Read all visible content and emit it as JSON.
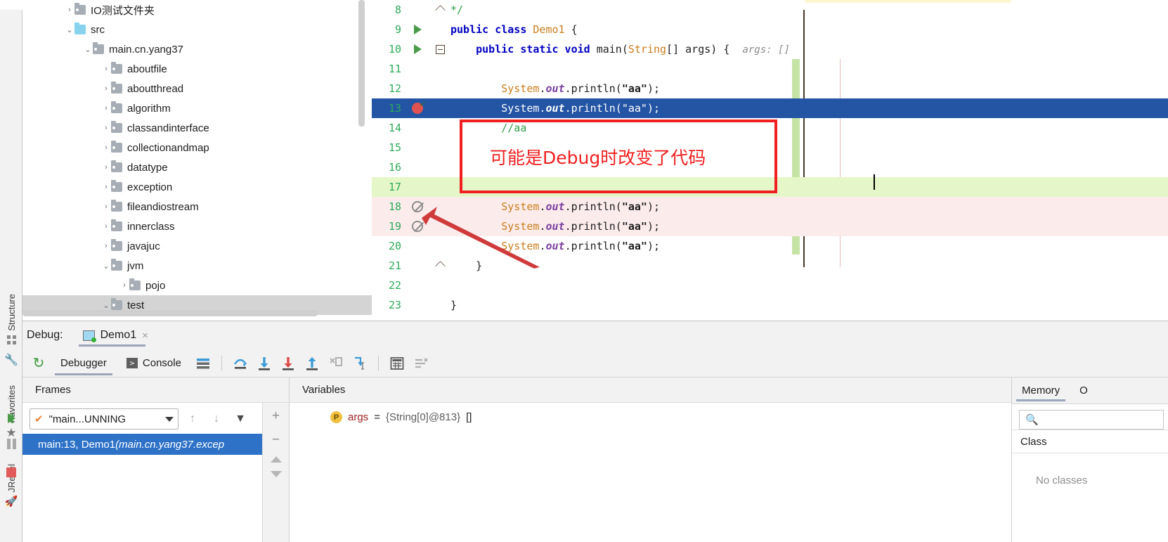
{
  "left_strip": {
    "tabs": [
      {
        "label": "Structure",
        "icon": "grid-icon"
      },
      {
        "label": "Favorites",
        "icon": "star-icon"
      },
      {
        "label": "JRebel",
        "icon": "rocket-icon"
      }
    ],
    "debug_controls": [
      {
        "name": "settings",
        "icon": "wrench-icon"
      },
      {
        "name": "resume",
        "icon": "resume-program-icon"
      },
      {
        "name": "pause",
        "icon": "pause-program-icon"
      },
      {
        "name": "stop",
        "icon": "stop-icon"
      }
    ]
  },
  "project_tree": {
    "items": [
      {
        "label": "IO测试文件夹",
        "arrow": "›",
        "indent": 1,
        "type": "folder",
        "expanded": false
      },
      {
        "label": "src",
        "arrow": "⌄",
        "indent": 1,
        "type": "source-root",
        "expanded": true
      },
      {
        "label": "main.cn.yang37",
        "arrow": "⌄",
        "indent": 2,
        "type": "package",
        "expanded": true
      },
      {
        "label": "aboutfile",
        "arrow": "›",
        "indent": 3,
        "type": "package",
        "expanded": false
      },
      {
        "label": "aboutthread",
        "arrow": "›",
        "indent": 3,
        "type": "package",
        "expanded": false
      },
      {
        "label": "algorithm",
        "arrow": "›",
        "indent": 3,
        "type": "package",
        "expanded": false
      },
      {
        "label": "classandinterface",
        "arrow": "›",
        "indent": 3,
        "type": "package",
        "expanded": false
      },
      {
        "label": "collectionandmap",
        "arrow": "›",
        "indent": 3,
        "type": "package",
        "expanded": false
      },
      {
        "label": "datatype",
        "arrow": "›",
        "indent": 3,
        "type": "package",
        "expanded": false
      },
      {
        "label": "exception",
        "arrow": "›",
        "indent": 3,
        "type": "package",
        "expanded": false
      },
      {
        "label": "fileandiostream",
        "arrow": "›",
        "indent": 3,
        "type": "package",
        "expanded": false
      },
      {
        "label": "innerclass",
        "arrow": "›",
        "indent": 3,
        "type": "package",
        "expanded": false
      },
      {
        "label": "javajuc",
        "arrow": "›",
        "indent": 3,
        "type": "package",
        "expanded": false
      },
      {
        "label": "jvm",
        "arrow": "⌄",
        "indent": 3,
        "type": "package",
        "expanded": true
      },
      {
        "label": "pojo",
        "arrow": "›",
        "indent": 4,
        "type": "package",
        "expanded": false
      },
      {
        "label": "test",
        "arrow": "⌄",
        "indent": 3,
        "type": "package",
        "expanded": true
      }
    ]
  },
  "editor": {
    "inlay_hint": "args: []",
    "lines": [
      {
        "num": "8",
        "gutter": "",
        "fold": "fold-up",
        "text": "*/",
        "state": "normal"
      },
      {
        "num": "9",
        "gutter": "run-arrow",
        "fold": "",
        "text": "public class Demo1 {",
        "state": "normal"
      },
      {
        "num": "10",
        "gutter": "run-arrow",
        "fold": "fold-minus",
        "text": "public static void main(String[] args) {",
        "state": "normal"
      },
      {
        "num": "11",
        "gutter": "",
        "fold": "",
        "text": "",
        "state": "normal"
      },
      {
        "num": "12",
        "gutter": "",
        "fold": "",
        "text": "System.out.println(\"aa\");",
        "state": "normal"
      },
      {
        "num": "13",
        "gutter": "breakpoint",
        "fold": "",
        "text": "System.out.println(\"aa\");",
        "state": "execution-point"
      },
      {
        "num": "14",
        "gutter": "",
        "fold": "",
        "text": "//aa",
        "state": "normal"
      },
      {
        "num": "15",
        "gutter": "",
        "fold": "",
        "text": "",
        "state": "normal"
      },
      {
        "num": "16",
        "gutter": "",
        "fold": "",
        "text": "",
        "state": "normal"
      },
      {
        "num": "17",
        "gutter": "",
        "fold": "",
        "text": "",
        "state": "caret-line"
      },
      {
        "num": "18",
        "gutter": "bp-muted",
        "fold": "",
        "text": "System.out.println(\"aa\");",
        "state": "modified"
      },
      {
        "num": "19",
        "gutter": "bp-muted",
        "fold": "",
        "text": "System.out.println(\"aa\");",
        "state": "modified"
      },
      {
        "num": "20",
        "gutter": "",
        "fold": "",
        "text": "System.out.println(\"aa\");",
        "state": "normal"
      },
      {
        "num": "21",
        "gutter": "",
        "fold": "fold-up",
        "text": "}",
        "state": "normal"
      },
      {
        "num": "22",
        "gutter": "",
        "fold": "",
        "text": "",
        "state": "normal"
      },
      {
        "num": "23",
        "gutter": "",
        "fold": "",
        "text": "}",
        "state": "normal"
      }
    ]
  },
  "annotation": {
    "text": "可能是Debug时改变了代码",
    "color": "#f02020"
  },
  "debug": {
    "title": "Debug:",
    "config_name": "Demo1",
    "close_label": "×",
    "toolbar": {
      "restart_icon": "rerun-icon",
      "tabs": [
        {
          "label": "Debugger",
          "icon": null,
          "active": true
        },
        {
          "label": "Console",
          "icon": "console-icon",
          "active": false
        }
      ],
      "buttons": [
        {
          "name": "layout-settings",
          "icon": "layout-icon"
        },
        {
          "name": "step-over",
          "icon": "step-over-icon"
        },
        {
          "name": "step-into",
          "icon": "step-into-icon"
        },
        {
          "name": "force-step-into",
          "icon": "force-step-into-icon"
        },
        {
          "name": "step-out",
          "icon": "step-out-icon"
        },
        {
          "name": "drop-frame",
          "icon": "drop-frame-icon"
        },
        {
          "name": "run-to-cursor",
          "icon": "run-to-cursor-icon"
        },
        {
          "name": "evaluate-expression",
          "icon": "calculator-icon"
        },
        {
          "name": "mute-breakpoints",
          "icon": "mute-breakpoints-icon"
        }
      ]
    },
    "frames": {
      "header": "Frames",
      "thread": "\"main...UNNING",
      "rows": [
        {
          "location": "main:13, Demo1 ",
          "package": "(main.cn.yang37.excep",
          "selected": true
        }
      ],
      "side_buttons": [
        "+",
        "−",
        "▲",
        "▼"
      ]
    },
    "variables": {
      "header": "Variables",
      "rows": [
        {
          "badge": "P",
          "name": "args",
          "eq": "=",
          "value": "{String[0]@813}",
          "extra": "[]"
        }
      ]
    },
    "memory": {
      "tabs": [
        {
          "label": "Memory",
          "active": true
        },
        {
          "label": "O",
          "active": false
        }
      ],
      "search_placeholder": "",
      "column_header": "Class",
      "empty_text": "No classes"
    }
  }
}
